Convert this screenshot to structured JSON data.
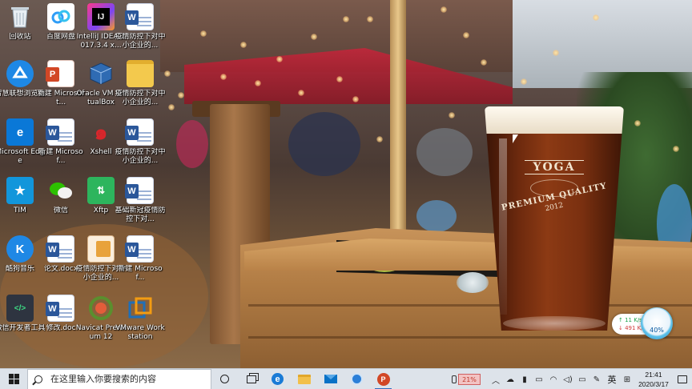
{
  "desktop": {
    "icons": [
      {
        "id": "recycle-bin",
        "label": "回收站"
      },
      {
        "id": "baidu-netdisk",
        "label": "百度网盘"
      },
      {
        "id": "intellij",
        "label": "IntelliJ IDEA 2017.3.4 x..."
      },
      {
        "id": "word-doc-1",
        "label": "疫情防控下对中小企业的..."
      },
      {
        "id": "smart-browser",
        "label": "智慧联想浏览器"
      },
      {
        "id": "new-ppt",
        "label": "新建 Microsoft..."
      },
      {
        "id": "virtualbox",
        "label": "Oracle VM VirtualBox"
      },
      {
        "id": "folder-epidemic",
        "label": "疫情防控下对中小企业的..."
      },
      {
        "id": "edge",
        "label": "Microsoft Edge"
      },
      {
        "id": "new-word-1",
        "label": "新建 Microsof..."
      },
      {
        "id": "xshell",
        "label": "Xshell"
      },
      {
        "id": "word-doc-2",
        "label": "疫情防控下对中小企业的..."
      },
      {
        "id": "tim",
        "label": "TIM"
      },
      {
        "id": "wechat",
        "label": "微信"
      },
      {
        "id": "xftp",
        "label": "Xftp"
      },
      {
        "id": "word-doc-3",
        "label": "基础新冠疫情防控下对..."
      },
      {
        "id": "kugou",
        "label": "酷狗音乐"
      },
      {
        "id": "thesis-doc",
        "label": "论文.docx"
      },
      {
        "id": "pdf-epidemic",
        "label": "疫情防控下对中小企业的..."
      },
      {
        "id": "new-word-2",
        "label": "新建 Microsof..."
      },
      {
        "id": "wechat-devtools",
        "label": "微信开发者工具"
      },
      {
        "id": "revise-doc",
        "label": "修改.doc"
      },
      {
        "id": "navicat",
        "label": "Navicat Premium 12"
      },
      {
        "id": "vmware",
        "label": "VMware Workstation"
      }
    ]
  },
  "wallpaper": {
    "glass_brand": "YOGA",
    "glass_tagline": "PREMIUM QUALITY",
    "glass_year": "2012"
  },
  "net_widget": {
    "upload": "↑ 11 K/s",
    "download": "↓ 491 K/s",
    "percent": "40%"
  },
  "taskbar": {
    "search_placeholder": "在这里输入你要搜索的内容",
    "battery_percent": "21%",
    "ime_label": "英",
    "time": "21:41",
    "date": "2020/3/17"
  },
  "colors": {
    "taskbar_bg": "#dde3ea",
    "accent": "#2f6cc0",
    "word_blue": "#2b579a",
    "ppt_red": "#d24726"
  }
}
